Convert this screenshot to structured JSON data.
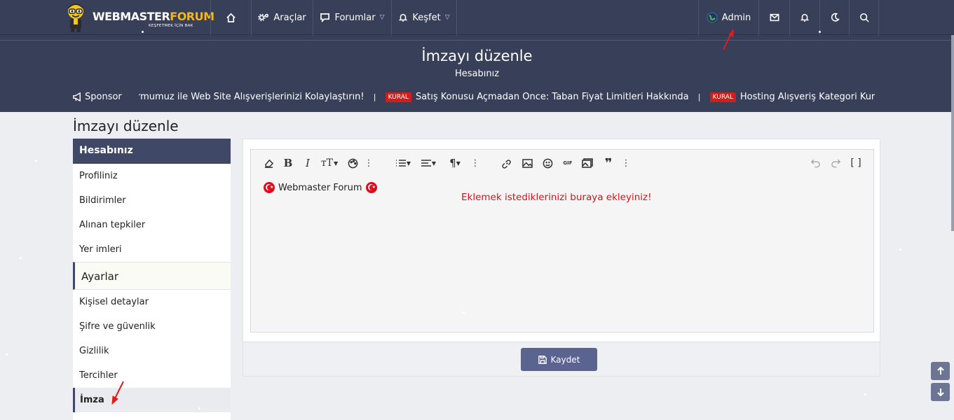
{
  "brand": {
    "logo_text_a": "WEBMASTER",
    "logo_text_b": "FORUM",
    "logo_tagline": "KEŞFETMEK İÇİN BAK"
  },
  "nav": {
    "tools": "Araçlar",
    "forums": "Forumlar",
    "explore": "Keşfet",
    "user": "Admin"
  },
  "header": {
    "title": "İmzayı düzenle",
    "subtitle": "Hesabınız"
  },
  "ticker": {
    "sponsor_label": "Sponsor",
    "items": [
      {
        "badge": "",
        "text": "Formumuz ile Web Site Alışverişlerinizi Kolaylaştırın!"
      },
      {
        "badge": "KURAL",
        "text": "Satış Konusu Açmadan Önce: Taban Fiyat Limitleri Hakkında"
      },
      {
        "badge": "KURAL",
        "text": "Hosting Alışveriş Kategori Kuralları"
      }
    ]
  },
  "content_title": "İmzayı düzenle",
  "sidebar": {
    "section1": "Hesabınız",
    "items1": [
      "Profiliniz",
      "Bildirimler",
      "Alınan tepkiler",
      "Yer imleri"
    ],
    "section2": "Ayarlar",
    "items2": [
      "Kişisel detaylar",
      "Şifre ve güvenlik",
      "Gizlilik",
      "Tercihler"
    ],
    "active": "İmza"
  },
  "editor": {
    "content": "Webmaster Forum",
    "hint": "Eklemek istediklerinizi buraya ekleyiniz!",
    "gif_label": "GIF"
  },
  "save_label": "Kaydet",
  "colors": {
    "header_bg": "#383f58",
    "accent": "#3f4867",
    "button": "#5b6491",
    "badge_red": "#d21d1d",
    "hint_red": "#d3131c"
  }
}
